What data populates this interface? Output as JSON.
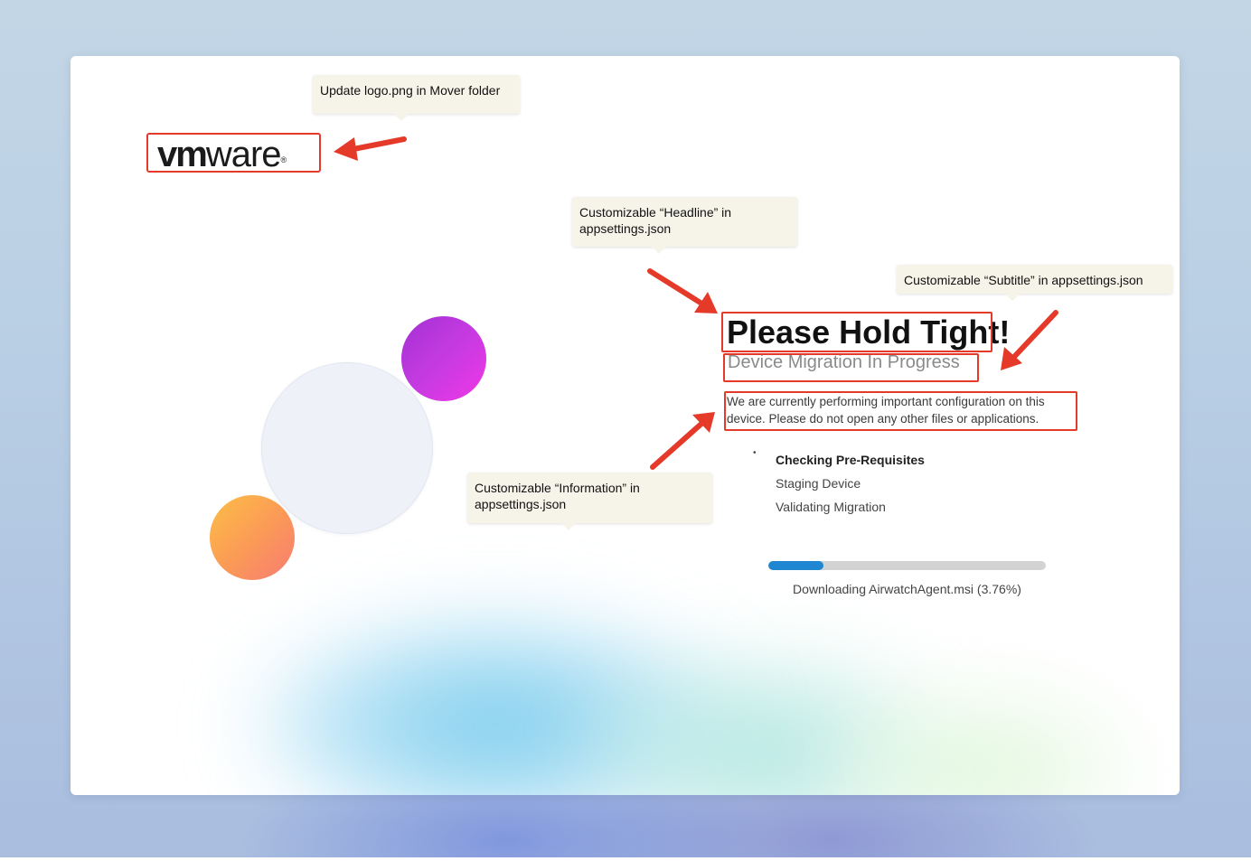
{
  "logo": {
    "brand_vm": "vm",
    "brand_ware": "ware",
    "registered": "®"
  },
  "headline": "Please Hold Tight!",
  "subtitle": "Device Migration In Progress",
  "information": "We are currently performing important configuration on this device. Please do not open any other files or applications.",
  "steps": [
    {
      "label": "Checking Pre-Requisites",
      "state": "active"
    },
    {
      "label": "Staging Device",
      "state": "pending"
    },
    {
      "label": "Validating Migration",
      "state": "pending"
    }
  ],
  "progress": {
    "fraction": 0.2,
    "text": "Downloading AirwatchAgent.msi (3.76%)"
  },
  "callouts": {
    "logo": "Update logo.png in Mover folder",
    "headline": "Customizable “Headline” in appsettings.json",
    "subtitle": "Customizable “Subtitle” in appsettings.json",
    "information": "Customizable “Information” in appsettings.json"
  },
  "colors": {
    "annotation_red": "#e53a2a",
    "progress_blue": "#1f86d2",
    "callout_bg": "#f6f3e9"
  }
}
